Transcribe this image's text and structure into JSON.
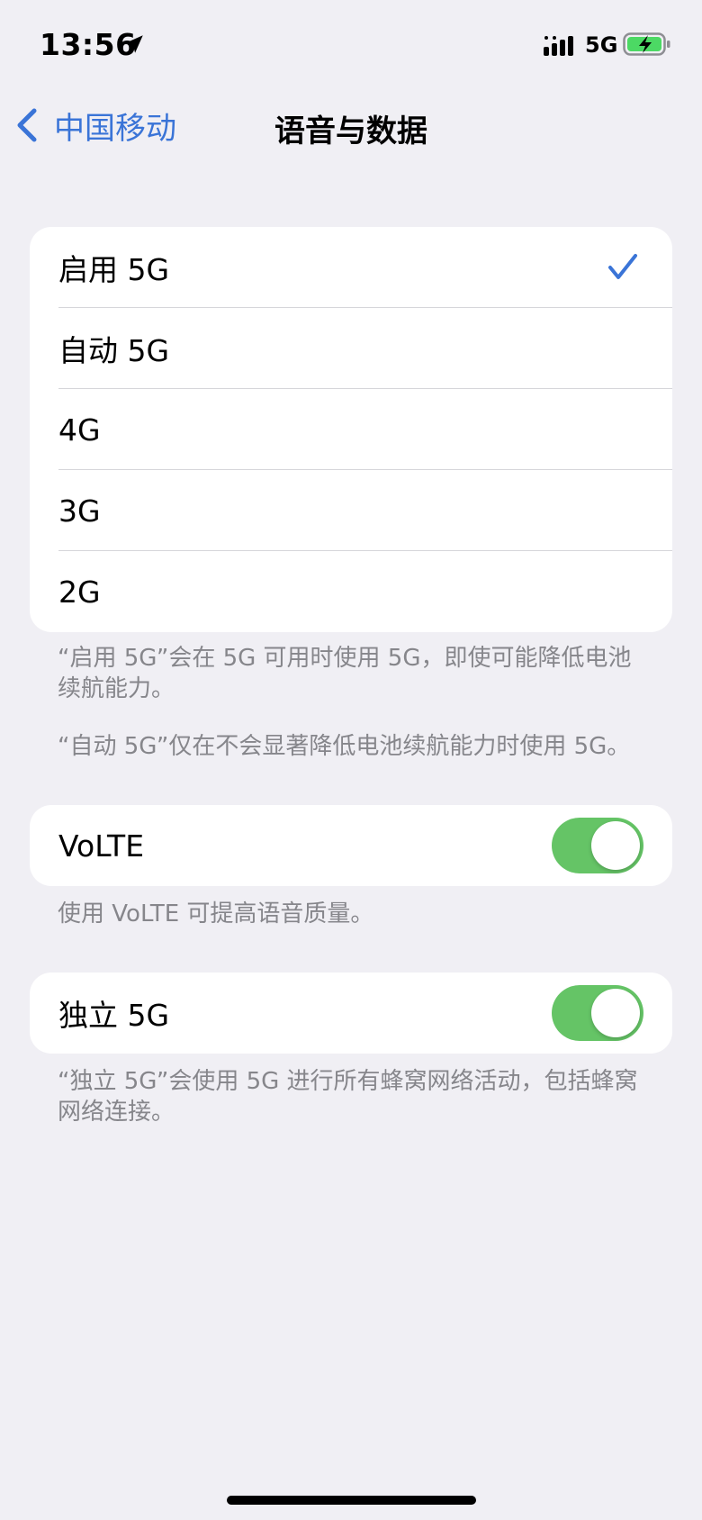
{
  "status_bar": {
    "time": "13:56",
    "location_icon": "location-arrow-icon",
    "signal_icon": "cellular-signal-icon",
    "network_type": "5G",
    "battery_icon": "battery-charging-icon"
  },
  "nav": {
    "back_label": "中国移动",
    "back_icon": "chevron-left-icon",
    "title": "语音与数据"
  },
  "network_options": {
    "items": [
      {
        "label": "启用 5G",
        "selected": true
      },
      {
        "label": "自动 5G",
        "selected": false
      },
      {
        "label": "4G",
        "selected": false
      },
      {
        "label": "3G",
        "selected": false
      },
      {
        "label": "2G",
        "selected": false
      }
    ],
    "selected_icon": "checkmark-icon",
    "footer_1": "“启用 5G”会在 5G 可用时使用 5G，即使可能降低电池续航能力。",
    "footer_2": "“自动 5G”仅在不会显著降低电池续航能力时使用 5G。"
  },
  "volte": {
    "label": "VoLTE",
    "enabled": true,
    "footer": "使用 VoLTE 可提高语音质量。"
  },
  "standalone_5g": {
    "label": "独立 5G",
    "enabled": true,
    "footer": "“独立 5G”会使用 5G 进行所有蜂窝网络活动，包括蜂窝网络连接。"
  },
  "colors": {
    "accent": "#3a74d7",
    "toggle_on": "#65c466",
    "background": "#f0eff4",
    "footer_text": "#86868b"
  }
}
